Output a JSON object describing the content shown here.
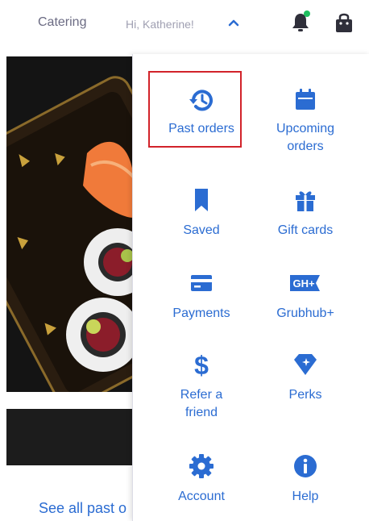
{
  "header": {
    "catering_label": "Catering",
    "greeting": "Hi, Katherine!",
    "notification_dot_color": "#1fbf5f",
    "icons": [
      "chevron-up-icon",
      "bell-icon",
      "shopping-bag-icon"
    ]
  },
  "menu": {
    "accent_color": "#2b6cd2",
    "items": [
      {
        "label": "Past orders",
        "icon": "history-icon"
      },
      {
        "label": "Upcoming\norders",
        "icon": "calendar-icon"
      },
      {
        "label": "Saved",
        "icon": "bookmark-icon"
      },
      {
        "label": "Gift cards",
        "icon": "gift-icon"
      },
      {
        "label": "Payments",
        "icon": "credit-card-icon"
      },
      {
        "label": "Grubhub+",
        "icon": "grubhub-plus-icon",
        "badge_text": "GH+"
      },
      {
        "label": "Refer a\nfriend",
        "icon": "dollar-icon"
      },
      {
        "label": "Perks",
        "icon": "diamond-icon"
      },
      {
        "label": "Account",
        "icon": "gear-icon"
      },
      {
        "label": "Help",
        "icon": "info-icon"
      }
    ]
  },
  "background": {
    "see_all_text": "See all past o"
  },
  "highlight_color": "#d2232a"
}
